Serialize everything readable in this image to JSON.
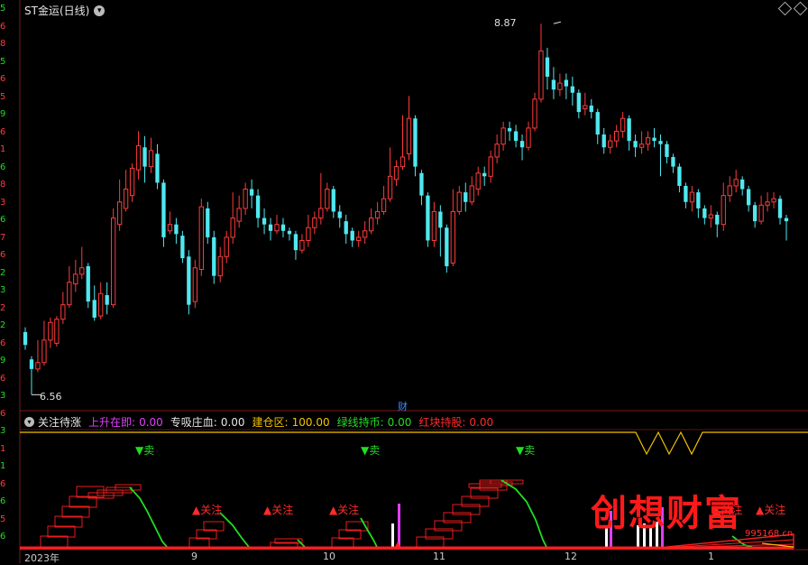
{
  "header": {
    "title": "ST金运(日线)",
    "dropdown_icon": "chevron-down-icon"
  },
  "price": {
    "high_label": "8.87",
    "low_label": "6.56",
    "fin_marker": "财"
  },
  "indicator": {
    "name": "关注待涨",
    "items": [
      {
        "label": "上升在即:",
        "value": "0.00",
        "color": "#e040fb"
      },
      {
        "label": "专吸庄血:",
        "value": "0.00",
        "color": "#e6e6e6"
      },
      {
        "label": "建仓区:",
        "value": "100.00",
        "color": "#f2c200"
      },
      {
        "label": "绿线持币:",
        "value": "0.00",
        "color": "#22dd22"
      },
      {
        "label": "红块持股:",
        "value": "0.00",
        "color": "#ff2b2b"
      }
    ]
  },
  "signals": {
    "sell": "▼卖",
    "watch": "▲关注"
  },
  "xaxis": [
    "2023年",
    "9",
    "10",
    "11",
    "12",
    "1"
  ],
  "yaxis_left_digits": [
    "5",
    "6",
    "8",
    "5",
    "6",
    "5",
    "9",
    "6",
    "1",
    "6",
    "8",
    "3",
    "6",
    "7",
    "6",
    "2",
    "3",
    "2",
    "2",
    "6",
    "9",
    "6",
    "3",
    "6",
    "3",
    "1",
    "1",
    "6",
    "6",
    "5",
    "6"
  ],
  "watermark": {
    "text": "创想财富",
    "url": "995168.cn"
  },
  "colors": {
    "up": "#ff3b3b",
    "down": "#4fe8f0",
    "yellow": "#f2c200",
    "green": "#22dd22",
    "red": "#ff2020",
    "magenta": "#e040fb"
  },
  "chart_data": {
    "type": "candlestick",
    "candles": [
      [
        6.95,
        6.87,
        6.98,
        6.84
      ],
      [
        6.78,
        6.72,
        6.8,
        6.56
      ],
      [
        6.72,
        6.76,
        6.9,
        6.7
      ],
      [
        6.76,
        6.9,
        7.02,
        6.74
      ],
      [
        6.9,
        7.01,
        7.04,
        6.85
      ],
      [
        6.88,
        7.03,
        7.05,
        6.86
      ],
      [
        7.03,
        7.12,
        7.2,
        7.0
      ],
      [
        7.12,
        7.26,
        7.36,
        7.1
      ],
      [
        7.25,
        7.31,
        7.4,
        7.2
      ],
      [
        7.31,
        7.35,
        7.48,
        7.28
      ],
      [
        7.36,
        7.14,
        7.38,
        7.1
      ],
      [
        7.15,
        7.04,
        7.24,
        7.02
      ],
      [
        7.05,
        7.19,
        7.26,
        7.03
      ],
      [
        7.18,
        7.12,
        7.26,
        7.06
      ],
      [
        7.12,
        7.66,
        7.72,
        7.1
      ],
      [
        7.62,
        7.76,
        7.9,
        7.58
      ],
      [
        7.72,
        7.84,
        7.96,
        7.7
      ],
      [
        7.8,
        7.97,
        8.0,
        7.76
      ],
      [
        7.96,
        8.11,
        8.2,
        7.9
      ],
      [
        8.1,
        7.98,
        8.17,
        7.88
      ],
      [
        7.98,
        8.08,
        8.16,
        7.94
      ],
      [
        8.06,
        7.88,
        8.12,
        7.84
      ],
      [
        7.88,
        7.54,
        7.9,
        7.48
      ],
      [
        7.58,
        7.62,
        7.7,
        7.56
      ],
      [
        7.62,
        7.56,
        7.66,
        7.5
      ],
      [
        7.55,
        7.41,
        7.58,
        7.38
      ],
      [
        7.42,
        7.12,
        7.46,
        7.06
      ],
      [
        7.14,
        7.35,
        7.4,
        7.1
      ],
      [
        7.34,
        7.73,
        7.78,
        7.3
      ],
      [
        7.72,
        7.54,
        7.76,
        7.5
      ],
      [
        7.54,
        7.3,
        7.58,
        7.25
      ],
      [
        7.3,
        7.42,
        7.48,
        7.26
      ],
      [
        7.42,
        7.54,
        7.58,
        7.38
      ],
      [
        7.54,
        7.66,
        7.82,
        7.5
      ],
      [
        7.64,
        7.72,
        7.8,
        7.6
      ],
      [
        7.72,
        7.84,
        7.88,
        7.68
      ],
      [
        7.84,
        7.8,
        7.9,
        7.72
      ],
      [
        7.8,
        7.66,
        7.84,
        7.6
      ],
      [
        7.66,
        7.62,
        7.72,
        7.56
      ],
      [
        7.62,
        7.58,
        7.66,
        7.52
      ],
      [
        7.58,
        7.62,
        7.68,
        7.56
      ],
      [
        7.62,
        7.58,
        7.66,
        7.54
      ],
      [
        7.58,
        7.56,
        7.6,
        7.52
      ],
      [
        7.56,
        7.46,
        7.58,
        7.4
      ],
      [
        7.46,
        7.52,
        7.56,
        7.44
      ],
      [
        7.52,
        7.6,
        7.68,
        7.48
      ],
      [
        7.6,
        7.66,
        7.7,
        7.56
      ],
      [
        7.66,
        7.72,
        7.94,
        7.62
      ],
      [
        7.72,
        7.84,
        7.88,
        7.7
      ],
      [
        7.84,
        7.7,
        7.86,
        7.66
      ],
      [
        7.7,
        7.66,
        7.74,
        7.6
      ],
      [
        7.64,
        7.56,
        7.68,
        7.5
      ],
      [
        7.58,
        7.52,
        7.6,
        7.48
      ],
      [
        7.52,
        7.54,
        7.58,
        7.48
      ],
      [
        7.54,
        7.58,
        7.64,
        7.5
      ],
      [
        7.58,
        7.66,
        7.72,
        7.56
      ],
      [
        7.66,
        7.7,
        7.76,
        7.62
      ],
      [
        7.7,
        7.78,
        7.86,
        7.68
      ],
      [
        7.78,
        7.92,
        8.1,
        7.76
      ],
      [
        7.9,
        7.98,
        8.02,
        7.86
      ],
      [
        7.98,
        8.04,
        8.3,
        7.96
      ],
      [
        8.06,
        8.28,
        8.42,
        8.02
      ],
      [
        8.28,
        7.98,
        8.3,
        7.92
      ],
      [
        7.94,
        7.8,
        7.96,
        7.74
      ],
      [
        7.8,
        7.52,
        7.82,
        7.48
      ],
      [
        7.52,
        7.7,
        7.76,
        7.48
      ],
      [
        7.7,
        7.6,
        7.74,
        7.42
      ],
      [
        7.6,
        7.36,
        7.62,
        7.32
      ],
      [
        7.38,
        7.7,
        7.84,
        7.36
      ],
      [
        7.7,
        7.82,
        7.86,
        7.68
      ],
      [
        7.82,
        7.76,
        7.88,
        7.7
      ],
      [
        7.76,
        7.86,
        7.92,
        7.74
      ],
      [
        7.84,
        7.94,
        7.98,
        7.8
      ],
      [
        7.94,
        7.92,
        7.98,
        7.86
      ],
      [
        7.92,
        8.04,
        8.08,
        7.88
      ],
      [
        8.04,
        8.12,
        8.18,
        8.0
      ],
      [
        8.12,
        8.22,
        8.26,
        8.08
      ],
      [
        8.22,
        8.2,
        8.26,
        8.14
      ],
      [
        8.2,
        8.14,
        8.24,
        8.1
      ],
      [
        8.14,
        8.1,
        8.18,
        8.02
      ],
      [
        8.1,
        8.22,
        8.26,
        8.08
      ],
      [
        8.22,
        8.4,
        8.44,
        8.2
      ],
      [
        8.4,
        8.7,
        8.87,
        8.38
      ],
      [
        8.66,
        8.54,
        8.72,
        8.46
      ],
      [
        8.52,
        8.46,
        8.6,
        8.4
      ],
      [
        8.46,
        8.5,
        8.56,
        8.42
      ],
      [
        8.52,
        8.48,
        8.56,
        8.4
      ],
      [
        8.48,
        8.44,
        8.54,
        8.36
      ],
      [
        8.44,
        8.32,
        8.46,
        8.28
      ],
      [
        8.34,
        8.36,
        8.44,
        8.3
      ],
      [
        8.36,
        8.32,
        8.4,
        8.28
      ],
      [
        8.32,
        8.18,
        8.34,
        8.12
      ],
      [
        8.18,
        8.1,
        8.22,
        8.06
      ],
      [
        8.1,
        8.14,
        8.18,
        8.06
      ],
      [
        8.14,
        8.2,
        8.24,
        8.1
      ],
      [
        8.2,
        8.28,
        8.32,
        8.16
      ],
      [
        8.28,
        8.14,
        8.3,
        8.08
      ],
      [
        8.14,
        8.1,
        8.18,
        8.04
      ],
      [
        8.1,
        8.12,
        8.2,
        8.06
      ],
      [
        8.12,
        8.16,
        8.2,
        8.08
      ],
      [
        8.16,
        8.14,
        8.22,
        8.1
      ],
      [
        8.14,
        8.12,
        8.18,
        7.92
      ],
      [
        8.12,
        8.04,
        8.14,
        8.0
      ],
      [
        8.04,
        7.98,
        8.06,
        7.94
      ],
      [
        7.98,
        7.86,
        8.0,
        7.82
      ],
      [
        7.86,
        7.76,
        7.88,
        7.72
      ],
      [
        7.76,
        7.82,
        7.86,
        7.7
      ],
      [
        7.82,
        7.72,
        7.84,
        7.66
      ],
      [
        7.72,
        7.66,
        7.74,
        7.62
      ],
      [
        7.66,
        7.68,
        7.74,
        7.6
      ],
      [
        7.68,
        7.62,
        7.7,
        7.54
      ],
      [
        7.62,
        7.8,
        7.88,
        7.58
      ],
      [
        7.8,
        7.86,
        7.92,
        7.76
      ],
      [
        7.86,
        7.9,
        7.96,
        7.82
      ],
      [
        7.9,
        7.84,
        7.92,
        7.8
      ],
      [
        7.84,
        7.74,
        7.86,
        7.7
      ],
      [
        7.74,
        7.64,
        7.76,
        7.6
      ],
      [
        7.64,
        7.74,
        7.8,
        7.62
      ],
      [
        7.74,
        7.76,
        7.82,
        7.7
      ],
      [
        7.76,
        7.78,
        7.82,
        7.72
      ],
      [
        7.78,
        7.66,
        7.8,
        7.62
      ],
      [
        7.66,
        7.64,
        7.68,
        7.52
      ]
    ],
    "xlabels": [
      "2023年",
      "9",
      "10",
      "11",
      "12",
      "1"
    ],
    "ylim": [
      6.5,
      8.95
    ]
  }
}
